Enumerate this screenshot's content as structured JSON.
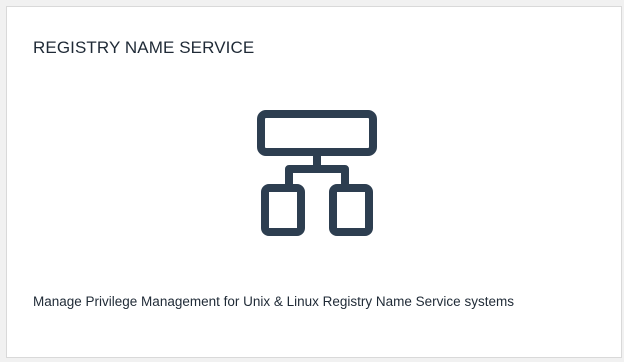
{
  "card": {
    "title": "REGISTRY NAME SERVICE",
    "icon": "hierarchy-network-icon",
    "description": "Manage Privilege Management for Unix & Linux Registry Name Service systems"
  },
  "colors": {
    "icon": "#2d3e50",
    "text": "#1f2a36",
    "card_background": "#ffffff",
    "card_border": "#d9d9d9",
    "page_background": "#f1f1f1"
  }
}
